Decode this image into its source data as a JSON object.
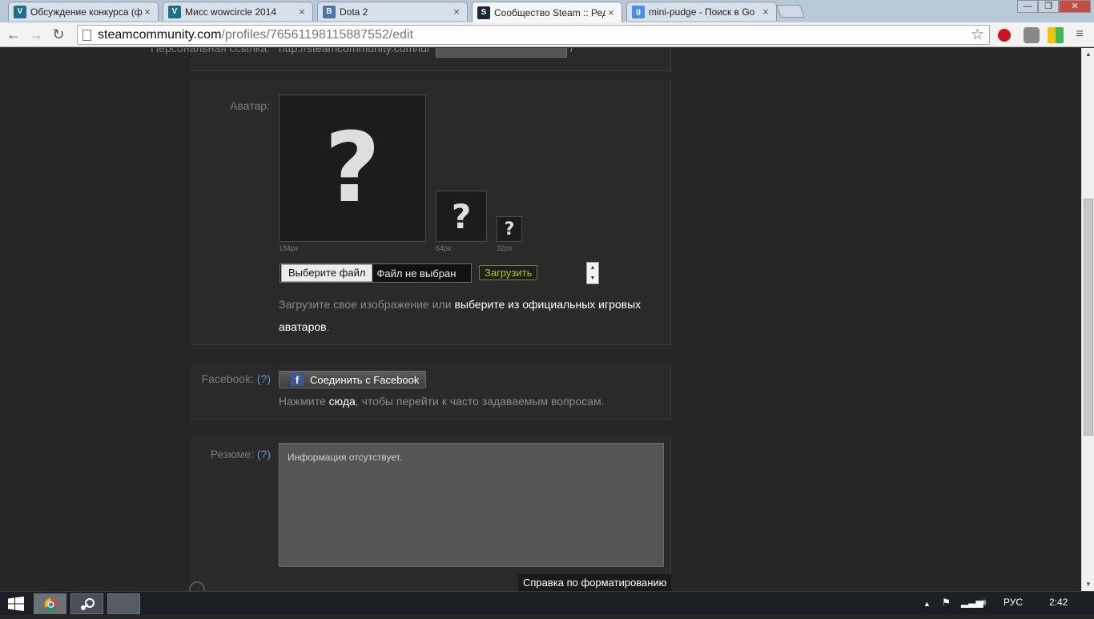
{
  "browser": {
    "tabs": [
      {
        "label": "Обсуждение конкурса (ф",
        "favicon": "V",
        "favicon_color": "#1b6f8a",
        "active": false
      },
      {
        "label": "Мисс wowcircle 2014",
        "favicon": "V",
        "favicon_color": "#1b6f8a",
        "active": false
      },
      {
        "label": "Dota 2",
        "favicon": "B",
        "favicon_color": "#4a76a8",
        "active": false
      },
      {
        "label": "Сообщество Steam :: Ред",
        "favicon": "S",
        "favicon_color": "#1b2838",
        "active": true
      },
      {
        "label": "mini-pudge - Поиск в Go",
        "favicon": "g",
        "favicon_color": "#4a8af4",
        "active": false
      }
    ],
    "close_glyph": "×",
    "address": {
      "host": "steamcommunity.com",
      "path": "/profiles/76561198115887552/edit"
    }
  },
  "page": {
    "custom_url": {
      "label": "Персональная ссылка:",
      "prefix": "http://steamcommunity.com/id/",
      "suffix": "/"
    },
    "avatar": {
      "label": "Аватар:",
      "sizes": [
        "184px",
        "64px",
        "32px"
      ],
      "placeholder_glyph": "?",
      "choose_file": "Выберите файл",
      "no_file": "Файл не выбран",
      "upload": "Загрузить",
      "hint_pre": "Загрузите свое изображение или ",
      "hint_link": "выберите из официальных игровых аватаров",
      "hint_post": "."
    },
    "facebook": {
      "label": "Facebook:",
      "help": "(?)",
      "connect": "Соединить с Facebook",
      "hint_pre": "Нажмите ",
      "hint_link": "сюда",
      "hint_post": ", чтобы перейти к часто задаваемым вопросам."
    },
    "summary": {
      "label": "Резюме:",
      "help": "(?)",
      "value": "Информация отсутствует.",
      "formatting_help": "Справка по форматированию"
    }
  },
  "taskbar": {
    "language": "РУС",
    "clock": "2:42"
  }
}
